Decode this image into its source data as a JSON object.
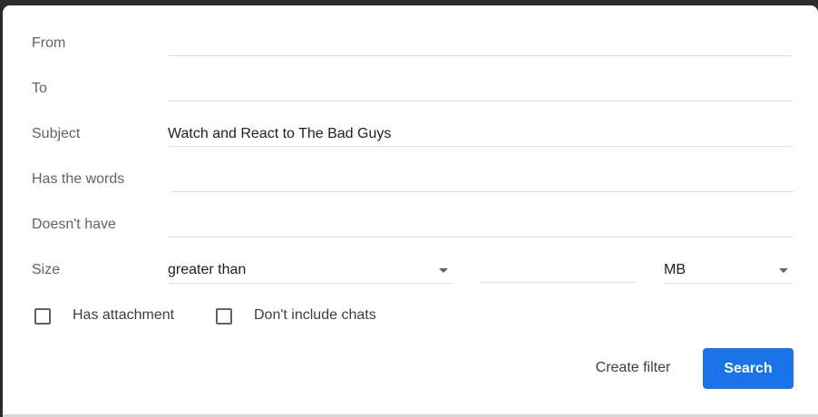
{
  "form": {
    "from": {
      "label": "From",
      "value": ""
    },
    "to": {
      "label": "To",
      "value": ""
    },
    "subject": {
      "label": "Subject",
      "value": "Watch and React to The Bad Guys"
    },
    "has_words": {
      "label": "Has the words",
      "value": ""
    },
    "doesnt_have": {
      "label": "Doesn't have",
      "value": ""
    },
    "size": {
      "label": "Size",
      "comparator": "greater than",
      "amount": "",
      "unit": "MB"
    },
    "checkboxes": {
      "has_attachment": {
        "label": "Has attachment",
        "checked": false
      },
      "no_chats": {
        "label": "Don't include chats",
        "checked": false
      }
    }
  },
  "actions": {
    "create_filter_label": "Create filter",
    "search_label": "Search"
  },
  "colors": {
    "primary": "#1a73e8",
    "label": "#5f6368",
    "text": "#202124"
  }
}
